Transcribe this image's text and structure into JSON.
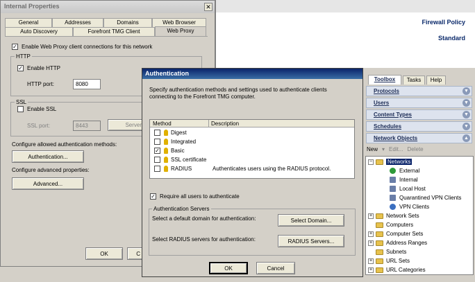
{
  "internal_properties": {
    "title": "Internal Properties",
    "tabs_row1": [
      "General",
      "Addresses",
      "Domains",
      "Web Browser"
    ],
    "tabs_row2": [
      "Auto Discovery",
      "Forefront TMG Client",
      "Web Proxy"
    ],
    "enable_web_proxy_label": "Enable Web Proxy client connections for this network",
    "http_group": "HTTP",
    "enable_http_label": "Enable HTTP",
    "http_port_label": "HTTP port:",
    "http_port_value": "8080",
    "ssl_group": "SSL",
    "enable_ssl_label": "Enable SSL",
    "ssl_port_label": "SSL port:",
    "ssl_port_value": "8443",
    "server_button": "Server",
    "auth_methods_label": "Configure allowed authentication methods:",
    "authentication_button": "Authentication...",
    "advanced_props_label": "Configure advanced properties:",
    "advanced_button": "Advanced...",
    "ok_button": "OK",
    "cancel_button_partial": "C"
  },
  "right_pane": {
    "title": "Firewall Policy",
    "subtitle": "Standard"
  },
  "toolbox": {
    "tabs": [
      "Toolbox",
      "Tasks",
      "Help"
    ],
    "sections": [
      "Protocols",
      "Users",
      "Content Types",
      "Schedules",
      "Network Objects"
    ],
    "actions": [
      "New",
      "Edit...",
      "Delete"
    ],
    "tree": [
      {
        "label": "Networks",
        "type": "folder-open"
      },
      {
        "label": "External",
        "type": "net"
      },
      {
        "label": "Internal",
        "type": "net"
      },
      {
        "label": "Local Host",
        "type": "net"
      },
      {
        "label": "Quarantined VPN Clients",
        "type": "net"
      },
      {
        "label": "VPN Clients",
        "type": "net"
      },
      {
        "label": "Network Sets",
        "type": "folder"
      },
      {
        "label": "Computers",
        "type": "folder"
      },
      {
        "label": "Computer Sets",
        "type": "folder"
      },
      {
        "label": "Address Ranges",
        "type": "folder"
      },
      {
        "label": "Subnets",
        "type": "folder"
      },
      {
        "label": "URL Sets",
        "type": "folder"
      },
      {
        "label": "URL Categories",
        "type": "folder"
      }
    ]
  },
  "auth_dialog": {
    "title": "Authentication",
    "description": "Specify authentication methods and settings used to authenticate clients connecting to the Forefront TMG computer.",
    "col_method": "Method",
    "col_description": "Description",
    "methods": [
      {
        "name": "Digest",
        "checked": false,
        "description": ""
      },
      {
        "name": "Integrated",
        "checked": false,
        "description": ""
      },
      {
        "name": "Basic",
        "checked": true,
        "description": ""
      },
      {
        "name": "SSL certificate",
        "checked": false,
        "description": ""
      },
      {
        "name": "RADIUS",
        "checked": false,
        "description": "Authenticates users using the RADIUS protocol."
      }
    ],
    "require_all_label": "Require all users to authenticate",
    "servers_group": "Authentication Servers",
    "default_domain_label": "Select a default domain for authentication:",
    "select_domain_button": "Select Domain...",
    "radius_label": "Select RADIUS servers for authentication:",
    "radius_button": "RADIUS Servers...",
    "ok_button": "OK",
    "cancel_button": "Cancel"
  }
}
